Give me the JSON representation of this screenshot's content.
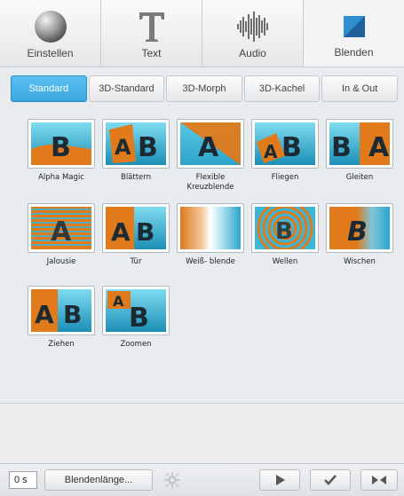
{
  "top_tabs": [
    {
      "label": "Einstellen",
      "icon": "sphere-icon"
    },
    {
      "label": "Text",
      "icon": "text-icon"
    },
    {
      "label": "Audio",
      "icon": "waveform-icon"
    },
    {
      "label": "Blenden",
      "icon": "transition-icon",
      "active": true
    }
  ],
  "sub_tabs": [
    {
      "label": "Standard",
      "active": true
    },
    {
      "label": "3D-Standard"
    },
    {
      "label": "3D-Morph"
    },
    {
      "label": "3D-Kachel"
    },
    {
      "label": "In & Out"
    }
  ],
  "transitions": [
    {
      "label": "Alpha Magic"
    },
    {
      "label": "Blättern"
    },
    {
      "label": "Flexible Kreuzblende"
    },
    {
      "label": "Fliegen"
    },
    {
      "label": "Gleiten"
    },
    {
      "label": "Jalousie"
    },
    {
      "label": "Tür"
    },
    {
      "label": "Weiß- blende"
    },
    {
      "label": "Wellen"
    },
    {
      "label": "Wischen"
    },
    {
      "label": "Ziehen"
    },
    {
      "label": "Zoomen"
    }
  ],
  "bottom_bar": {
    "duration": "0 s",
    "length_button": "Blendenlänge...",
    "icons": [
      "gear-icon",
      "play-icon",
      "check-icon",
      "apply-all-icon"
    ]
  },
  "colors": {
    "accent": "#3aa6e0",
    "thumb_orange": "#e07a1a",
    "thumb_cyan": "#3bb7d8"
  }
}
